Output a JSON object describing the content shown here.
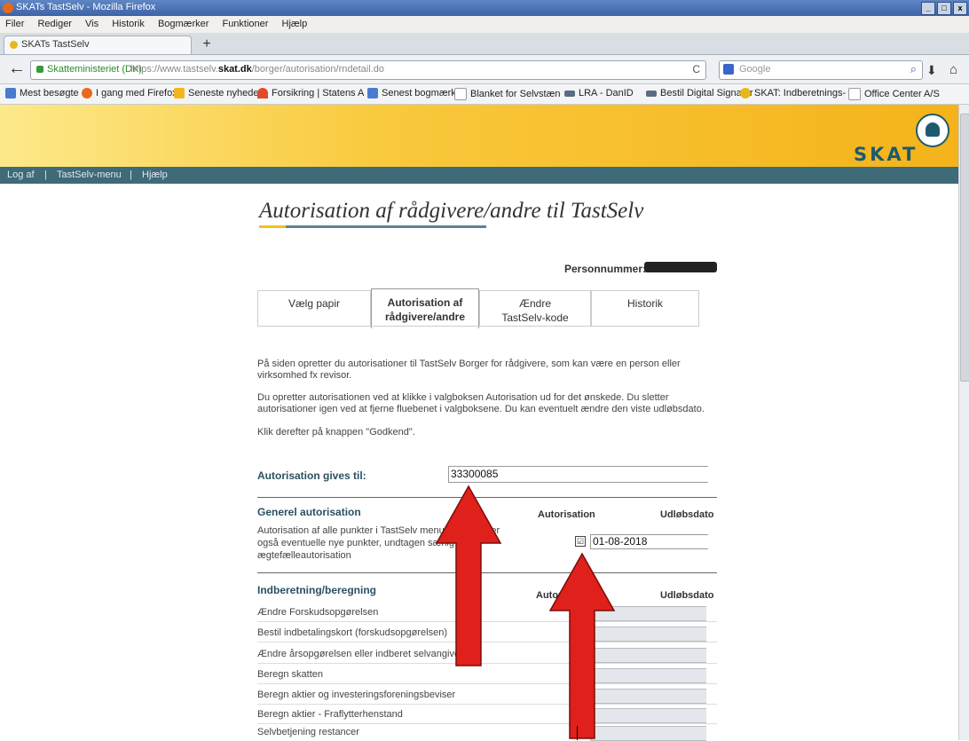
{
  "window": {
    "title": "SKATs TastSelv - Mozilla Firefox",
    "controls": [
      "_",
      "□",
      "x"
    ]
  },
  "menu": [
    "Filer",
    "Rediger",
    "Vis",
    "Historik",
    "Bogmærker",
    "Funktioner",
    "Hjælp"
  ],
  "browser_tab": {
    "label": "SKATs TastSelv",
    "new_tab": "+"
  },
  "nav": {
    "back": "←",
    "site_identity": "Skatteministeriet (DK)",
    "url_prefix": "https://www.tastselv.",
    "url_domain": "skat.dk",
    "url_path": "/borger/autorisation/rndetail.do",
    "reload": "C",
    "search_placeholder": "Google",
    "search_icon": "⌕",
    "download_icon": "⬇",
    "home_icon": "⌂"
  },
  "bookmarks": [
    "Mest besøgte",
    "I gang med Firefox",
    "Seneste nyheder",
    "Forsikring | Statens A",
    "Senest bogmærket",
    "Blanket for Selvstæn",
    "LRA - DanID",
    "Bestil Digital Signatur",
    "SKAT: Indberetnings-",
    "Office Center A/S"
  ],
  "site": {
    "logo": "SKAT",
    "topnav": [
      "Log af",
      "|",
      "TastSelv-menu",
      "|",
      "Hjælp"
    ]
  },
  "page": {
    "title": "Autorisation af rådgivere/andre til TastSelv",
    "personnummer_label": "Personnummer:",
    "tabs": [
      {
        "line1": "Vælg papir",
        "line2": ""
      },
      {
        "line1": "Autorisation af",
        "line2": "rådgivere/andre"
      },
      {
        "line1": "Ændre",
        "line2": "TastSelv-kode"
      },
      {
        "line1": "Historik",
        "line2": ""
      }
    ],
    "para1": "På siden opretter du autorisationer til TastSelv Borger for rådgivere, som kan være en person eller virksomhed fx revisor.",
    "para2": "Du opretter autorisationen ved at klikke i valgboksen Autorisation ud for det ønskede. Du sletter autorisationer igen ved at fjerne fluebenet i valgboksene. Du kan eventuelt ændre den viste udløbsdato.",
    "para3": "Klik derefter på knappen \"Godkend\"."
  },
  "form": {
    "auth_label": "Autorisation gives til:",
    "auth_value": "33300085",
    "general": {
      "heading": "Generel autorisation",
      "col_auth": "Autorisation",
      "col_date": "Udløbsdato",
      "text": "Autorisation af alle punkter i TastSelv menuen, herunder også eventuelle nye punkter, undtagen særlig ægtefælleautorisation",
      "checked": "☑",
      "date": "01-08-2018"
    },
    "reporting": {
      "heading": "Indberetning/beregning",
      "col_auth": "Autorisation",
      "col_date": "Udløbsdato",
      "rows": [
        "Ændre Forskudsopgørelsen",
        "Bestil indbetalingskort (forskudsopgørelsen)",
        "Ændre årsopgørelsen eller indberet selvangivelse",
        "Beregn skatten",
        "Beregn aktier og investeringsforeningsbeviser",
        "Beregn aktier - Fraflytterhenstand",
        "Selvbetjening restancer"
      ]
    }
  },
  "colors": {
    "arrow": "#e0201a",
    "accent": "#f2c21b",
    "teal": "#3f6a78"
  }
}
